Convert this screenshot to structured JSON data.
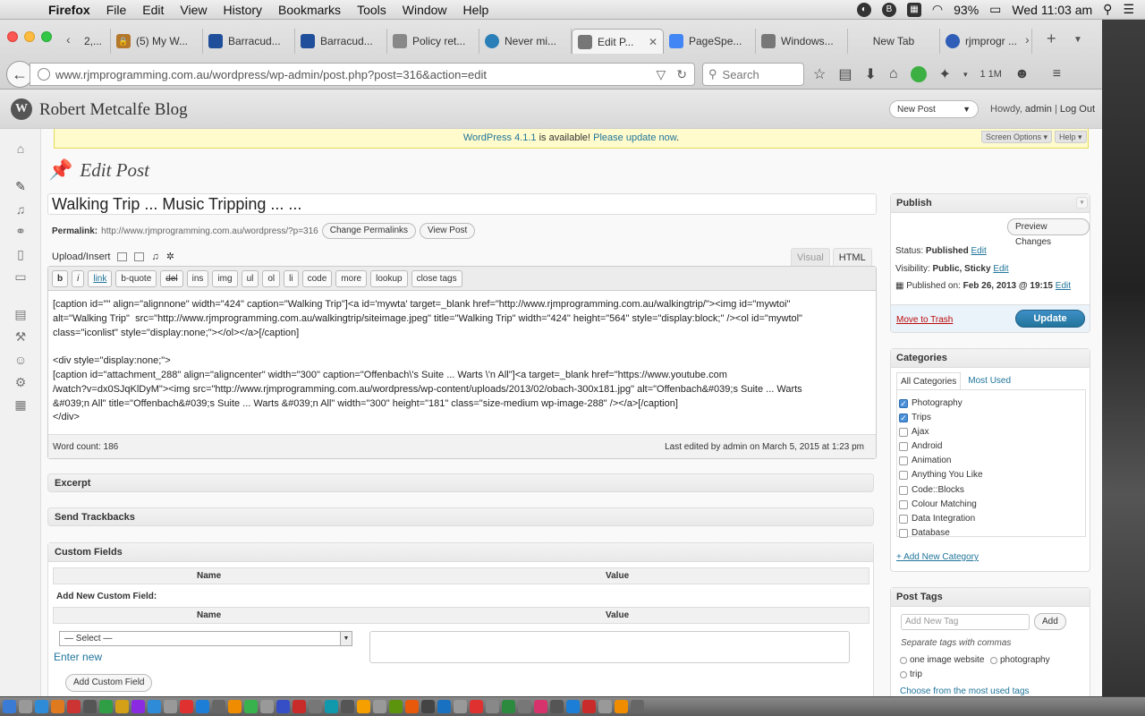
{
  "macmenu": {
    "app": "Firefox",
    "items": [
      "File",
      "Edit",
      "View",
      "History",
      "Bookmarks",
      "Tools",
      "Window",
      "Help"
    ],
    "battery": "93%",
    "clock": "Wed 11:03 am"
  },
  "browser": {
    "tabs": [
      {
        "label": "2,..."
      },
      {
        "label": "(5) My W..."
      },
      {
        "label": "Barracud..."
      },
      {
        "label": "Barracud..."
      },
      {
        "label": "Policy ret..."
      },
      {
        "label": "Never mi..."
      },
      {
        "label": "Edit P...",
        "active": true
      },
      {
        "label": "PageSpe..."
      },
      {
        "label": "Windows..."
      },
      {
        "label": "New Tab"
      },
      {
        "label": "rjmprogr ..."
      }
    ],
    "url": "www.rjmprogramming.com.au/wordpress/wp-admin/post.php?post=316&action=edit",
    "search_placeholder": "Search",
    "counter": "1 1M"
  },
  "wp": {
    "blog_name": "Robert Metcalfe Blog",
    "new_post_select": "New Post",
    "howdy_prefix": "Howdy, ",
    "user": "admin",
    "logout": "Log Out",
    "notice_link1": "WordPress 4.1.1",
    "notice_mid": " is available! ",
    "notice_link2": "Please update now",
    "notice_end": ".",
    "screen_options": "Screen Options ▾",
    "help": "Help ▾",
    "page_title": "Edit Post",
    "post_title": "Walking Trip ... Music Tripping ... ...",
    "permalink_label": "Permalink:",
    "permalink_url": "http://www.rjmprogramming.com.au/wordpress/?p=316",
    "change_permalinks": "Change Permalinks",
    "view_post": "View Post",
    "upload_insert": "Upload/Insert",
    "tab_visual": "Visual",
    "tab_html": "HTML",
    "quicktags": [
      "b",
      "i",
      "link",
      "b-quote",
      "del",
      "ins",
      "img",
      "ul",
      "ol",
      "li",
      "code",
      "more",
      "lookup",
      "close tags"
    ],
    "content": "[caption id=\"\" align=\"alignnone\" width=\"424\" caption=\"Walking Trip\"]<a id='mywta' target=_blank href=\"http://www.rjmprogramming.com.au/walkingtrip/\"><img id=\"mywtoi\"\nalt=\"Walking Trip\"  src=\"http://www.rjmprogramming.com.au/walkingtrip/siteimage.jpeg\" title=\"Walking Trip\" width=\"424\" height=\"564\" style=\"display:block;\" /><ol id=\"mywtol\"\nclass=\"iconlist\" style=\"display:none;\"></ol></a>[/caption]\n\n<div style=\"display:none;\">\n[caption id=\"attachment_288\" align=\"aligncenter\" width=\"300\" caption=\"Offenbach\\'s Suite ... Warts \\'n All\"]<a target=_blank href=\"https://www.youtube.com\n/watch?v=dx0SJqKlDyM\"><img src=\"http://www.rjmprogramming.com.au/wordpress/wp-content/uploads/2013/02/obach-300x181.jpg\" alt=\"Offenbach&#039;s Suite ... Warts\n&#039;n All\" title=\"Offenbach&#039;s Suite ... Warts &#039;n All\" width=\"300\" height=\"181\" class=\"size-medium wp-image-288\" /></a>[/caption]\n</div>",
    "word_count": "Word count: 186",
    "last_edited": "Last edited by admin on March 5, 2015 at 1:23 pm",
    "box_excerpt": "Excerpt",
    "box_trackbacks": "Send Trackbacks",
    "custom_fields": {
      "title": "Custom Fields",
      "col_name": "Name",
      "col_value": "Value",
      "add_new": "Add New Custom Field:",
      "select": "— Select —",
      "enter_new": "Enter new",
      "add_button": "Add Custom Field"
    },
    "publish": {
      "title": "Publish",
      "preview": "Preview Changes",
      "status_label": "Status: ",
      "status": "Published",
      "visibility_label": "Visibility: ",
      "visibility": "Public, Sticky",
      "published_label": "Published on: ",
      "published": "Feb 26, 2013 @ 19:15",
      "edit": "Edit",
      "trash": "Move to Trash",
      "update": "Update"
    },
    "categories": {
      "title": "Categories",
      "tab_all": "All Categories",
      "tab_used": "Most Used",
      "items": [
        {
          "label": "Photography",
          "checked": true
        },
        {
          "label": "Trips",
          "checked": true
        },
        {
          "label": "Ajax",
          "checked": false
        },
        {
          "label": "Android",
          "checked": false
        },
        {
          "label": "Animation",
          "checked": false
        },
        {
          "label": "Anything You Like",
          "checked": false
        },
        {
          "label": "Code::Blocks",
          "checked": false
        },
        {
          "label": "Colour Matching",
          "checked": false
        },
        {
          "label": "Data Integration",
          "checked": false
        },
        {
          "label": "Database",
          "checked": false
        }
      ],
      "add_new": "+ Add New Category"
    },
    "tags": {
      "title": "Post Tags",
      "placeholder": "Add New Tag",
      "add": "Add",
      "separate": "Separate tags with commas",
      "chips": [
        "one image website",
        "photography",
        "trip"
      ],
      "choose": "Choose from the most used tags"
    }
  }
}
